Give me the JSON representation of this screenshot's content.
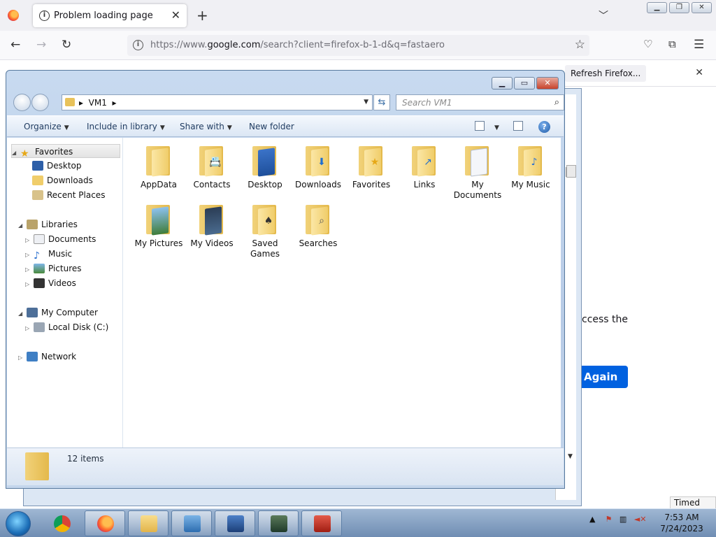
{
  "browser": {
    "tab_title": "Problem loading page",
    "url_prefix": "https://www.",
    "url_domain": "google.com",
    "url_rest": "/search?client=firefox-b-1-d&q=fastaero",
    "notification_button": "Refresh Firefox...",
    "error_text": "ccess the",
    "error_button": "Again"
  },
  "explorer": {
    "breadcrumb": "VM1",
    "search_placeholder": "Search VM1",
    "commands": {
      "organize": "Organize",
      "include_in_library": "Include in library",
      "share_with": "Share with",
      "new_folder": "New folder"
    },
    "nav": {
      "favorites": "Favorites",
      "desktop": "Desktop",
      "downloads": "Downloads",
      "recent_places": "Recent Places",
      "libraries": "Libraries",
      "documents": "Documents",
      "music": "Music",
      "pictures": "Pictures",
      "videos": "Videos",
      "my_computer": "My Computer",
      "local_disk": "Local Disk (C:)",
      "network": "Network"
    },
    "folders": [
      {
        "name": "AppData",
        "icon": "appdata-icon"
      },
      {
        "name": "Contacts",
        "icon": "contacts-icon"
      },
      {
        "name": "Desktop",
        "icon": "desktop-icon"
      },
      {
        "name": "Downloads",
        "icon": "downloads-icon"
      },
      {
        "name": "Favorites",
        "icon": "favorites-icon"
      },
      {
        "name": "Links",
        "icon": "links-icon"
      },
      {
        "name": "My Documents",
        "icon": "documents-icon"
      },
      {
        "name": "My Music",
        "icon": "music-icon"
      },
      {
        "name": "My Pictures",
        "icon": "pictures-icon"
      },
      {
        "name": "My Videos",
        "icon": "videos-icon"
      },
      {
        "name": "Saved Games",
        "icon": "saved-games-icon"
      },
      {
        "name": "Searches",
        "icon": "searches-icon"
      }
    ],
    "item_count": "12 items"
  },
  "tooltip": "Timed Out",
  "taskbar": {
    "time": "7:53 AM",
    "date": "7/24/2023"
  },
  "colors": {
    "firefox_blue": "#0061e0",
    "folder_yellow": "#f0cd6a",
    "taskbar": "#8aa6c8"
  }
}
